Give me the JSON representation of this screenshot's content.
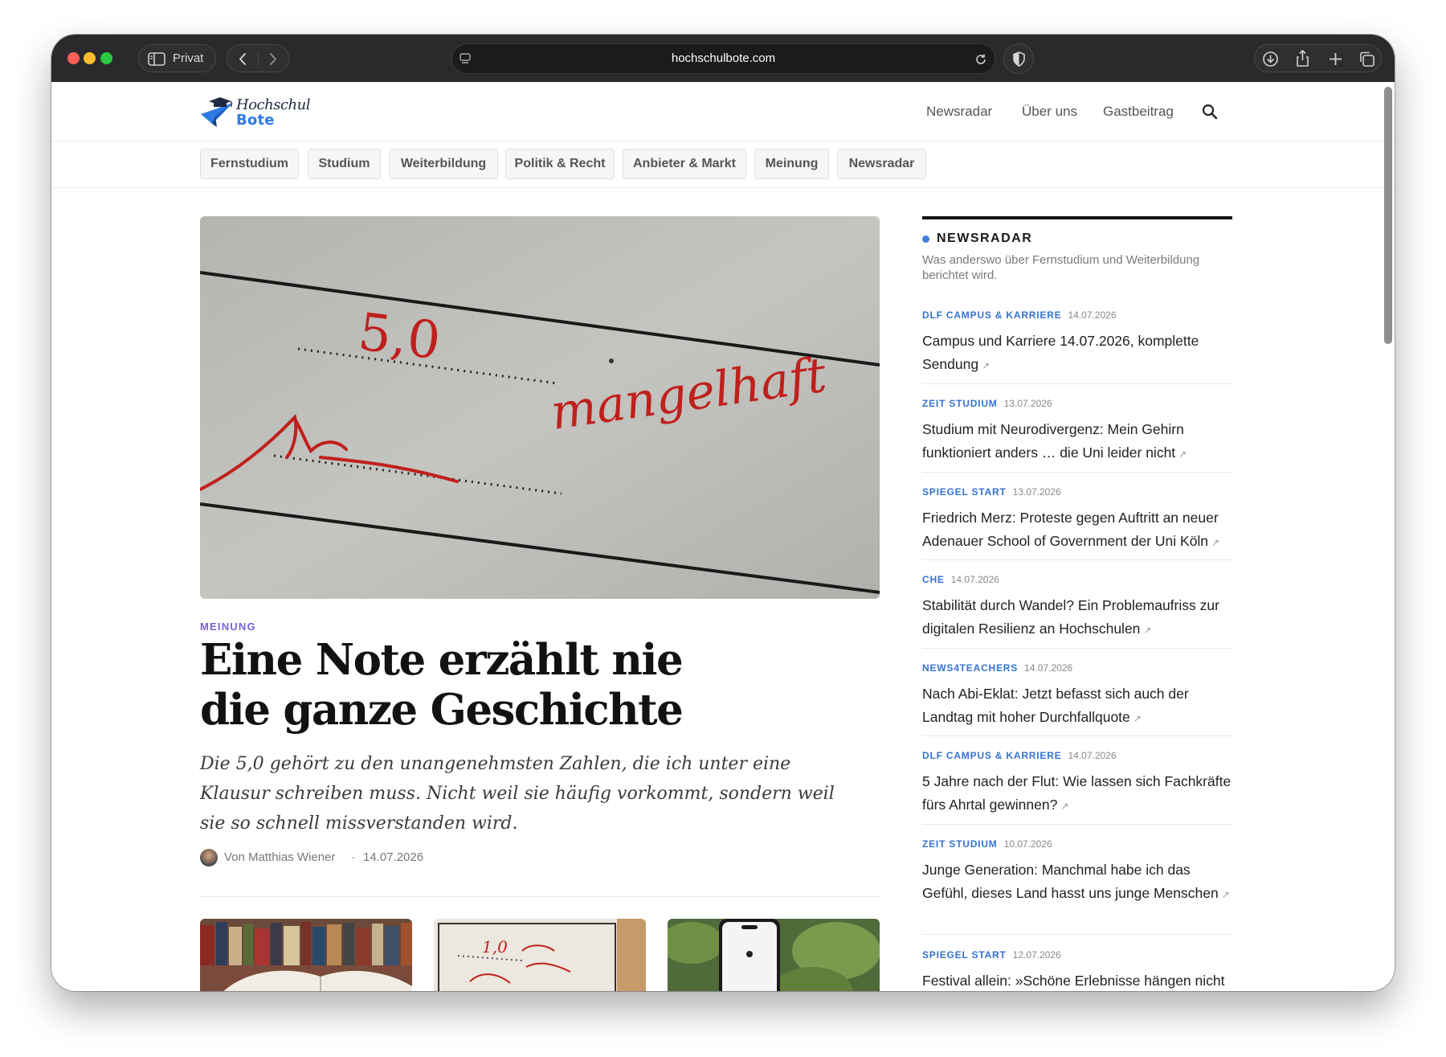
{
  "browser": {
    "private_label": "Privat",
    "url": "hochschulbote.com",
    "traffic_light_colors": {
      "close": "#ff5f57",
      "minimize": "#febc2e",
      "zoom": "#28c840"
    }
  },
  "site": {
    "logo_line1": "Hochschul",
    "logo_line2": "Bote",
    "nav": [
      "Newsradar",
      "Über uns",
      "Gastbeitrag"
    ],
    "categories": [
      "Fernstudium",
      "Studium",
      "Weiterbildung",
      "Politik & Recht",
      "Anbieter & Markt",
      "Meinung",
      "Newsradar"
    ]
  },
  "article": {
    "kicker": "MEINUNG",
    "headline_line1": "Eine Note erzählt nie",
    "headline_line2": "die ganze Geschichte",
    "lead": "Die 5,0 gehört zu den unangenehmsten Zahlen, die ich unter eine Klausur schreiben muss. Nicht weil sie häufig vorkommt, sondern weil sie so schnell missverstanden wird.",
    "author": "Von Matthias Wiener",
    "sep": "·",
    "date": "14.07.2026",
    "hero_grade": "5,0",
    "hero_word": "mangelhaft",
    "thumb2_grade": "1,0"
  },
  "sidebar": {
    "title": "NEWSRADAR",
    "subtitle": "Was anderswo über Fernstudium und Weiterbildung berichtet wird.",
    "arrow": "↗",
    "items": [
      {
        "source": "DLF CAMPUS & KARRIERE",
        "date": "14.07.2026",
        "title": "Campus und Karriere 14.07.2026, komplette Sendung"
      },
      {
        "source": "ZEIT STUDIUM",
        "date": "13.07.2026",
        "title": "Studium mit Neurodivergenz: Mein Gehirn funktioniert anders … die Uni leider nicht"
      },
      {
        "source": "SPIEGEL START",
        "date": "13.07.2026",
        "title": "Friedrich Merz: Proteste gegen Auftritt an neuer Adenauer School of Government der Uni Köln"
      },
      {
        "source": "CHE",
        "date": "14.07.2026",
        "title": "Stabilität durch Wandel? Ein Problemaufriss zur digitalen Resilienz an Hochschulen"
      },
      {
        "source": "NEWS4TEACHERS",
        "date": "14.07.2026",
        "title": "Nach Abi-Eklat: Jetzt befasst sich auch der Landtag mit hoher Durchfallquote"
      },
      {
        "source": "DLF CAMPUS & KARRIERE",
        "date": "14.07.2026",
        "title": "5 Jahre nach der Flut: Wie lassen sich Fachkräfte fürs Ahrtal gewinnen?"
      },
      {
        "source": "ZEIT STUDIUM",
        "date": "10.07.2026",
        "title": "Junge Generation: Manchmal habe ich das Gefühl, dieses Land hasst uns junge Menschen"
      },
      {
        "source": "SPIEGEL START",
        "date": "12.07.2026",
        "title": "Festival allein: »Schöne Erlebnisse hängen nicht"
      }
    ]
  }
}
